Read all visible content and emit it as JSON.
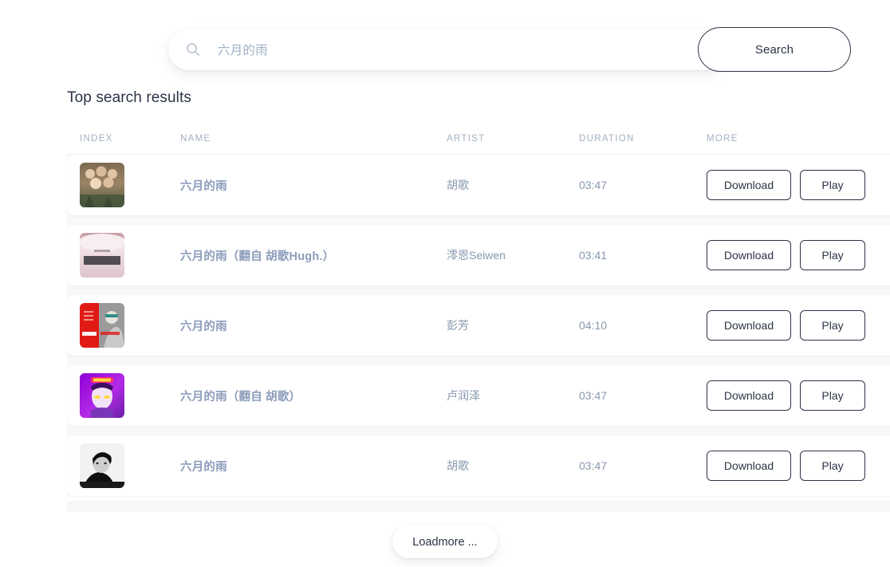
{
  "search": {
    "icon": "search-icon",
    "value": "六月的雨",
    "placeholder": "六月的雨",
    "button_label": "Search"
  },
  "results": {
    "title": "Top search results",
    "columns": {
      "index": "INDEX",
      "name": "NAME",
      "artist": "ARTIST",
      "duration": "DURATION",
      "more": "MORE"
    },
    "rows": [
      {
        "name": "六月的雨",
        "artist": "胡歌",
        "duration": "03:47",
        "download_label": "Download",
        "play_label": "Play",
        "art": "album-art-vintage-group"
      },
      {
        "name": "六月的雨（翻自 胡歌Hugh.）",
        "artist": "澪恩Seiwen",
        "duration": "03:41",
        "download_label": "Download",
        "play_label": "Play",
        "art": "album-art-pink-text"
      },
      {
        "name": "六月的雨",
        "artist": "彭芳",
        "duration": "04:10",
        "download_label": "Download",
        "play_label": "Play",
        "art": "album-art-red-beauty"
      },
      {
        "name": "六月的雨（翻自 胡歌）",
        "artist": "卢润泽",
        "duration": "03:47",
        "download_label": "Download",
        "play_label": "Play",
        "art": "album-art-purple-portrait"
      },
      {
        "name": "六月的雨",
        "artist": "胡歌",
        "duration": "03:47",
        "download_label": "Download",
        "play_label": "Play",
        "art": "album-art-bw-portrait"
      }
    ]
  },
  "footer": {
    "loadmore_label": "Loadmore ..."
  },
  "colors": {
    "text_dark": "#2b3445",
    "text_muted": "#8798ae",
    "track_name": "#8b9cba",
    "header_muted": "#a3b0c2",
    "surface": "#ffffff",
    "table_background": "#f7f8fa"
  }
}
